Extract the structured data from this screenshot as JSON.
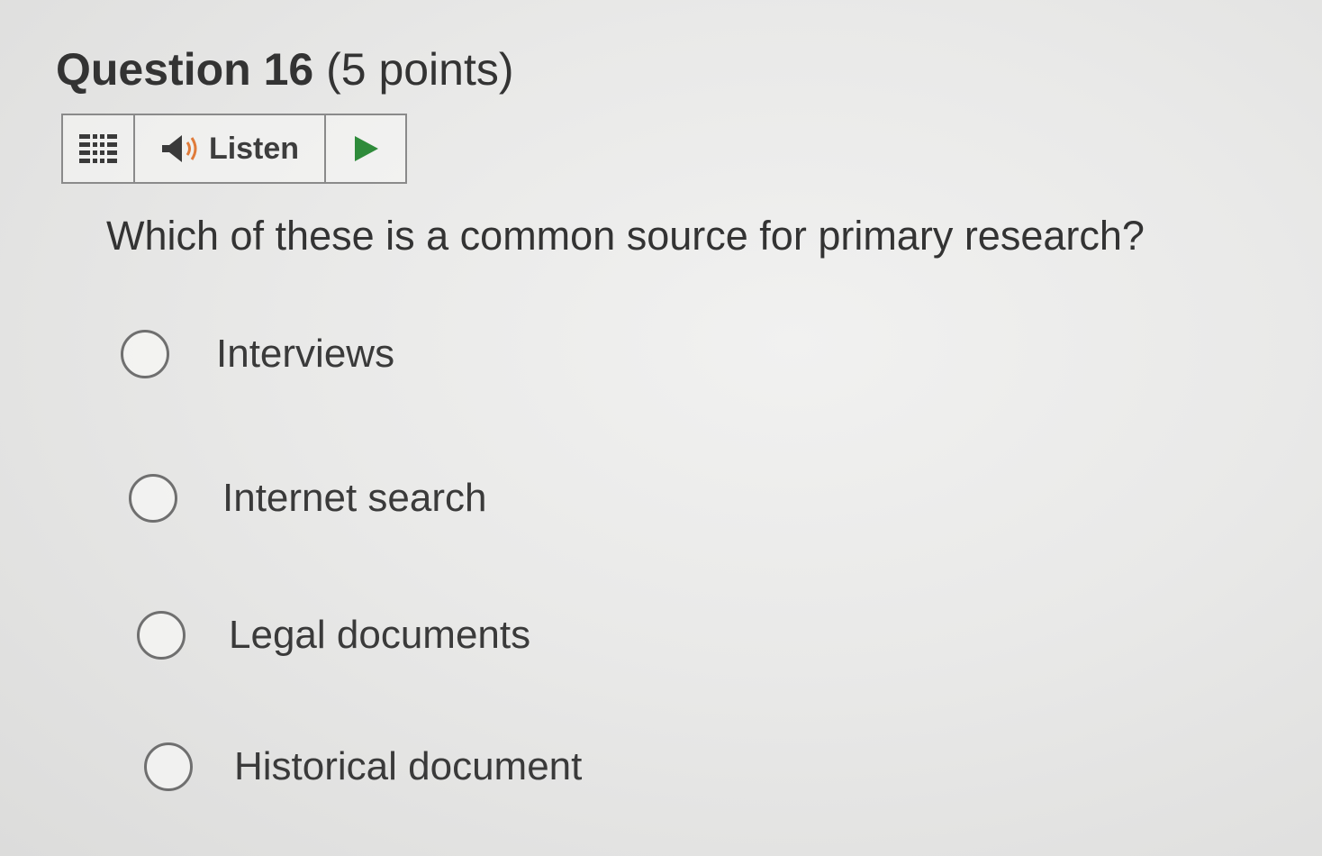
{
  "question": {
    "title": "Question 16",
    "points": "(5 points)",
    "text": "Which of these is a common source for primary research?"
  },
  "toolbar": {
    "menu_icon": "menu-lines-icon",
    "listen_icon": "speaker-icon",
    "listen_label": "Listen",
    "play_icon": "play-icon",
    "play_color": "#2e8b3a"
  },
  "options": [
    {
      "label": "Interviews",
      "selected": false
    },
    {
      "label": "Internet search",
      "selected": false
    },
    {
      "label": "Legal documents",
      "selected": false
    },
    {
      "label": "Historical document",
      "selected": false
    }
  ]
}
